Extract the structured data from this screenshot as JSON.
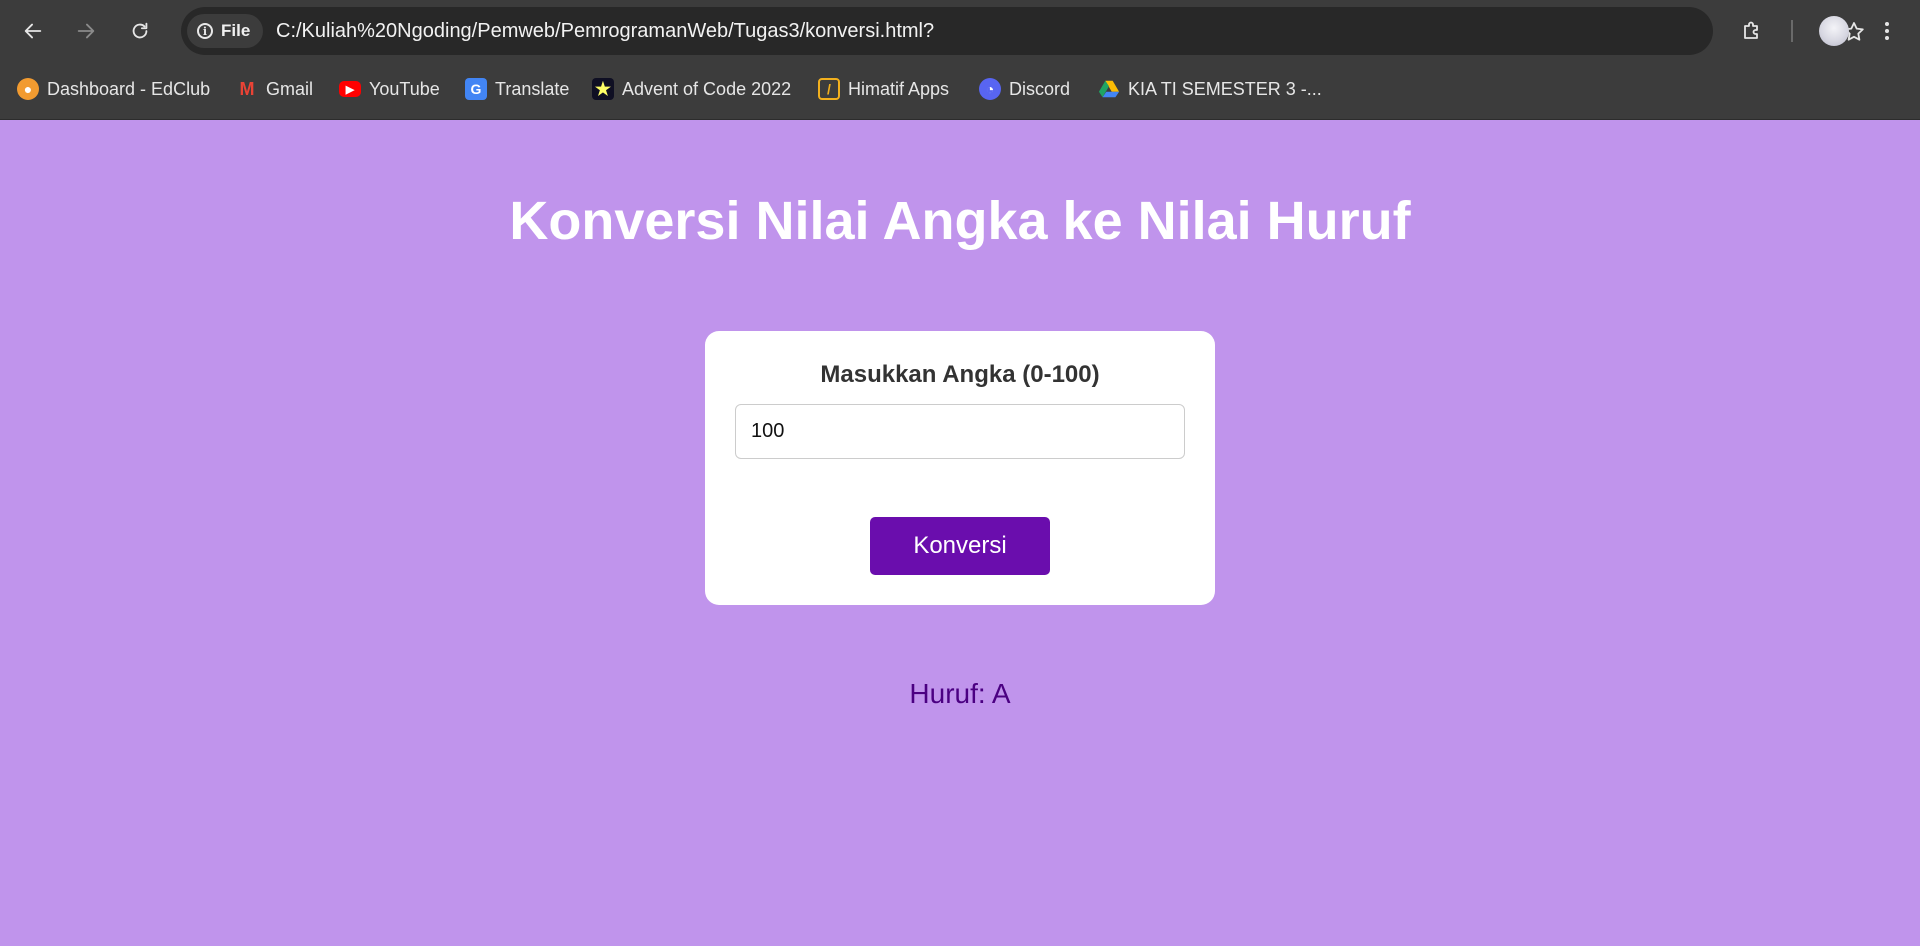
{
  "browser": {
    "site_chip_label": "File",
    "url": "C:/Kuliah%20Ngoding/Pemweb/PemrogramanWeb/Tugas3/konversi.html?",
    "bookmarks": [
      {
        "label": "Dashboard - EdClub",
        "icon": "edclub-icon"
      },
      {
        "label": "Gmail",
        "icon": "gmail-icon"
      },
      {
        "label": "YouTube",
        "icon": "youtube-icon"
      },
      {
        "label": "Translate",
        "icon": "translate-icon"
      },
      {
        "label": "Advent of Code 2022",
        "icon": "advent-of-code-icon"
      },
      {
        "label": "Himatif Apps",
        "icon": "himatif-icon"
      },
      {
        "label": "Discord",
        "icon": "discord-icon"
      },
      {
        "label": "KIA TI SEMESTER 3 -...",
        "icon": "google-drive-icon"
      }
    ]
  },
  "page": {
    "title": "Konversi Nilai Angka ke Nilai Huruf",
    "form": {
      "label": "Masukkan Angka (0-100)",
      "input_value": "100",
      "button_label": "Konversi"
    },
    "result_text": "Huruf: A"
  },
  "colors": {
    "background": "#c094ec",
    "button": "#6a0dad",
    "result_text": "#4b0082"
  }
}
